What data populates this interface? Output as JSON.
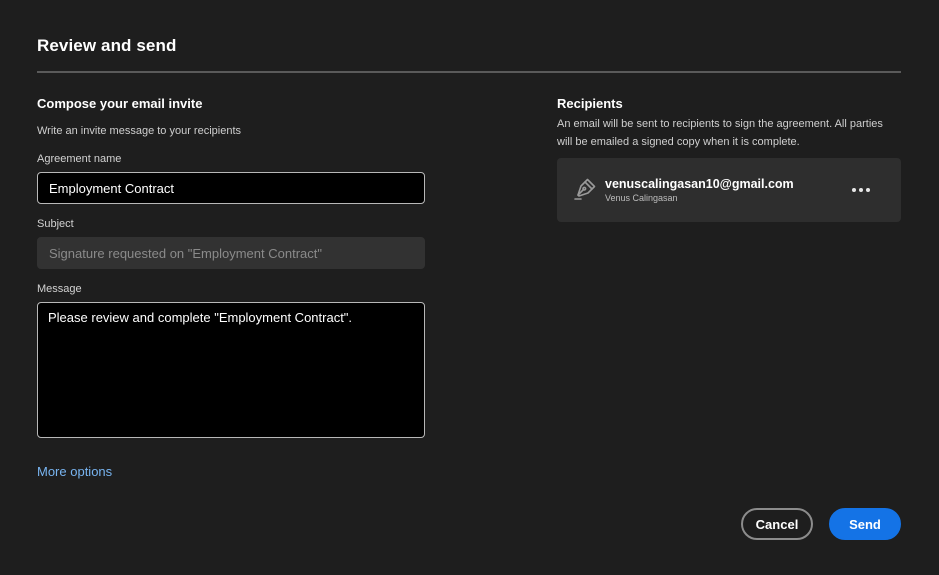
{
  "dialog": {
    "title": "Review and send"
  },
  "compose": {
    "heading": "Compose your email invite",
    "description": "Write an invite message to your recipients",
    "agreement_name": {
      "label": "Agreement name",
      "value": "Employment Contract"
    },
    "subject": {
      "label": "Subject",
      "placeholder": "Signature requested on \"Employment Contract\""
    },
    "message": {
      "label": "Message",
      "value": "Please review and complete \"Employment Contract\"."
    },
    "more_options_label": "More options"
  },
  "recipients": {
    "heading": "Recipients",
    "description": "An email will be sent to recipients to sign the agreement. All parties will be emailed a signed copy when it is complete.",
    "items": [
      {
        "email": "venuscalingasan10@gmail.com",
        "name": "Venus Calingasan",
        "role_icon": "pen-icon"
      }
    ]
  },
  "footer": {
    "cancel_label": "Cancel",
    "send_label": "Send"
  },
  "colors": {
    "background": "#1e1e1e",
    "accent": "#1473e6",
    "link": "#78b4f0"
  }
}
